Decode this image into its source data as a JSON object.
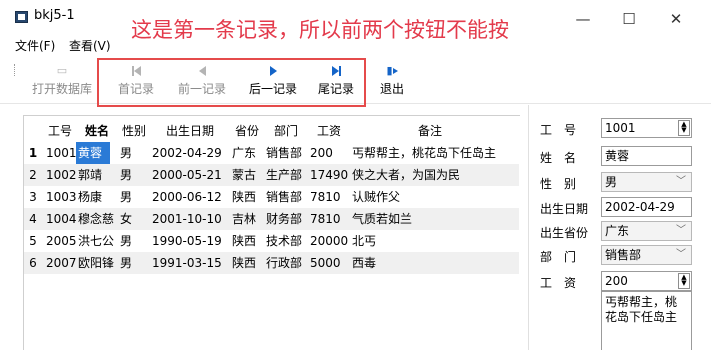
{
  "window": {
    "title": "bkj5-1",
    "annotation": "这是第一条记录，所以前两个按钮不能按",
    "controls": {
      "minimize": "—",
      "maximize": "☐",
      "close": "✕"
    }
  },
  "menu": [
    "文件(F)",
    "查看(V)"
  ],
  "toolbar": [
    {
      "label": "打开数据库",
      "icon": "open-db-icon",
      "enabled": false
    },
    {
      "label": "首记录",
      "icon": "first-record-icon",
      "enabled": false
    },
    {
      "label": "前一记录",
      "icon": "prev-record-icon",
      "enabled": false
    },
    {
      "label": "后一记录",
      "icon": "next-record-icon",
      "enabled": true
    },
    {
      "label": "尾记录",
      "icon": "last-record-icon",
      "enabled": true
    },
    {
      "label": "退出",
      "icon": "exit-icon",
      "enabled": true
    }
  ],
  "table": {
    "headers": [
      "工号",
      "姓名",
      "性别",
      "出生日期",
      "省份",
      "部门",
      "工资",
      "备注"
    ],
    "current_row": 1,
    "rows": [
      {
        "num": "1",
        "cells": [
          "1001",
          "黄蓉",
          "男",
          "2002-04-29",
          "广东",
          "销售部",
          "200",
          "丐帮帮主，桃花岛下任岛主"
        ]
      },
      {
        "num": "2",
        "cells": [
          "1002",
          "郭靖",
          "男",
          "2000-05-21",
          "蒙古",
          "生产部",
          "17490",
          "侠之大者，为国为民"
        ]
      },
      {
        "num": "3",
        "cells": [
          "1003",
          "杨康",
          "男",
          "2000-06-12",
          "陕西",
          "销售部",
          "7810",
          "认贼作父"
        ]
      },
      {
        "num": "4",
        "cells": [
          "1004",
          "穆念慈",
          "女",
          "2001-10-10",
          "吉林",
          "财务部",
          "7810",
          "气质若如兰"
        ]
      },
      {
        "num": "5",
        "cells": [
          "2005",
          "洪七公",
          "男",
          "1990-05-19",
          "陕西",
          "技术部",
          "20000",
          "北丐"
        ]
      },
      {
        "num": "6",
        "cells": [
          "2007",
          "欧阳锋",
          "男",
          "1991-03-15",
          "陕西",
          "行政部",
          "5000",
          "西毒"
        ]
      }
    ]
  },
  "form": {
    "fields": [
      {
        "label": "工　号",
        "value": "1001",
        "type": "spin"
      },
      {
        "label": "姓　名",
        "value": "黄蓉",
        "type": "text"
      },
      {
        "label": "性　别",
        "value": "男",
        "type": "combo"
      },
      {
        "label": "出生日期",
        "value": "2002-04-29",
        "type": "text"
      },
      {
        "label": "出生省份",
        "value": "广东",
        "type": "combo"
      },
      {
        "label": "部　门",
        "value": "销售部",
        "type": "combo"
      },
      {
        "label": "工　资",
        "value": "200",
        "type": "spin"
      }
    ],
    "memo": "丐帮帮主，桃花岛下任岛主"
  }
}
